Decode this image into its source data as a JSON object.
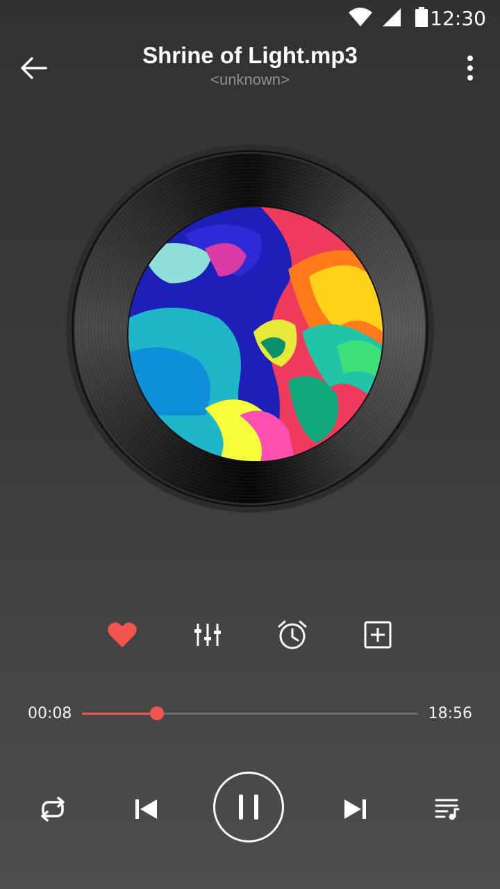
{
  "status_bar": {
    "time": "12:30",
    "icons": [
      "wifi-icon",
      "signal-icon",
      "battery-icon"
    ]
  },
  "header": {
    "title": "Shrine of Light.mp3",
    "subtitle": "<unknown>"
  },
  "actions": [
    "heart-icon",
    "equalizer-icon",
    "alarm-icon",
    "add-to-playlist-icon"
  ],
  "player": {
    "current_time": "00:08",
    "total_time": "18:56",
    "progress_fraction": 0.223,
    "state": "playing"
  },
  "controls": [
    "repeat-icon",
    "previous-icon",
    "pause-icon",
    "next-icon",
    "queue-icon"
  ],
  "colors": {
    "accent": "#f2544f",
    "background": "#3b3a3b",
    "subtitle": "#8f8f8f"
  }
}
